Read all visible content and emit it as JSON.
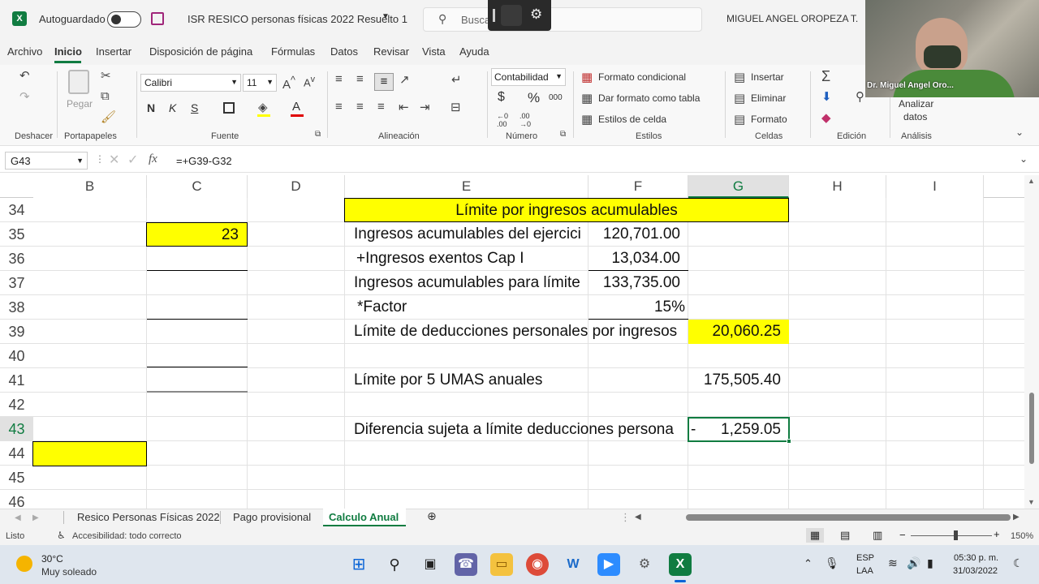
{
  "titlebar": {
    "app_icon": "excel-icon",
    "autosave_label": "Autoguardado",
    "file_title": "ISR RESICO personas físicas 2022 Resuelto 1",
    "search_placeholder": "Busca",
    "user_name": "MIGUEL ANGEL OROPEZA T."
  },
  "menu": [
    "Archivo",
    "Inicio",
    "Insertar",
    "Disposición de página",
    "Fórmulas",
    "Datos",
    "Revisar",
    "Vista",
    "Ayuda"
  ],
  "ribbon": {
    "groups": {
      "undo": "Deshacer",
      "clipboard": "Portapapeles",
      "font": "Fuente",
      "alignment": "Alineación",
      "number": "Número",
      "styles": "Estilos",
      "cells": "Celdas",
      "editing": "Edición",
      "analysis": "Análisis"
    },
    "paste_label": "Pegar",
    "font_name": "Calibri",
    "font_size": "11",
    "bold": "N",
    "italic": "K",
    "underline": "S",
    "number_format": "Contabilidad",
    "conditional_format": "Formato condicional",
    "format_as_table": "Dar formato como tabla",
    "cell_styles": "Estilos de celda",
    "insert": "Insertar",
    "delete": "Eliminar",
    "format": "Formato",
    "analyze_data_1": "Analizar",
    "analyze_data_2": "datos",
    "currency_symbol": "$",
    "percent_symbol": "%",
    "thousands_symbol": "000"
  },
  "video": {
    "caption": "Dr. Miguel Angel Oro..."
  },
  "formula_bar": {
    "name_box": "G43",
    "fx": "fx",
    "formula": "=+G39-G32"
  },
  "columns": [
    "B",
    "C",
    "D",
    "E",
    "F",
    "G",
    "H",
    "I"
  ],
  "rows": [
    "34",
    "35",
    "36",
    "37",
    "38",
    "39",
    "40",
    "41",
    "42",
    "43",
    "44",
    "45",
    "46"
  ],
  "cells": {
    "E34": "Límite por ingresos acumulables",
    "C35": "23",
    "E35": "Ingresos acumulables del ejercici",
    "F35": "120,701.00",
    "E36": "+Ingresos exentos Cap I",
    "F36": "13,034.00",
    "E37": "Ingresos acumulables para límite",
    "F37": "133,735.00",
    "E38": "*Factor",
    "F38": "15%",
    "E39": "Límite de deducciones personales por ingresos",
    "G39": "20,060.25",
    "E41": "Límite por 5 UMAS anuales",
    "G41": "175,505.40",
    "E43": "Diferencia sujeta a límite deducciones persona",
    "G43_sign": "-",
    "G43": "1,259.05"
  },
  "sheet_tabs": [
    "Resico Personas Físicas 2022",
    "Pago provisional",
    "Calculo Anual"
  ],
  "active_tab": "Calculo Anual",
  "status": {
    "ready": "Listo",
    "accessibility": "Accesibilidad: todo correcto",
    "zoom": "150%"
  },
  "taskbar": {
    "weather_temp": "30°C",
    "weather_desc": "Muy soleado",
    "lang_1": "ESP",
    "lang_2": "LAA",
    "time": "05:30 p. m.",
    "date": "31/03/2022"
  },
  "colors": {
    "highlight": "#ffff00",
    "excel_green": "#217346",
    "selection": "#107c41"
  }
}
